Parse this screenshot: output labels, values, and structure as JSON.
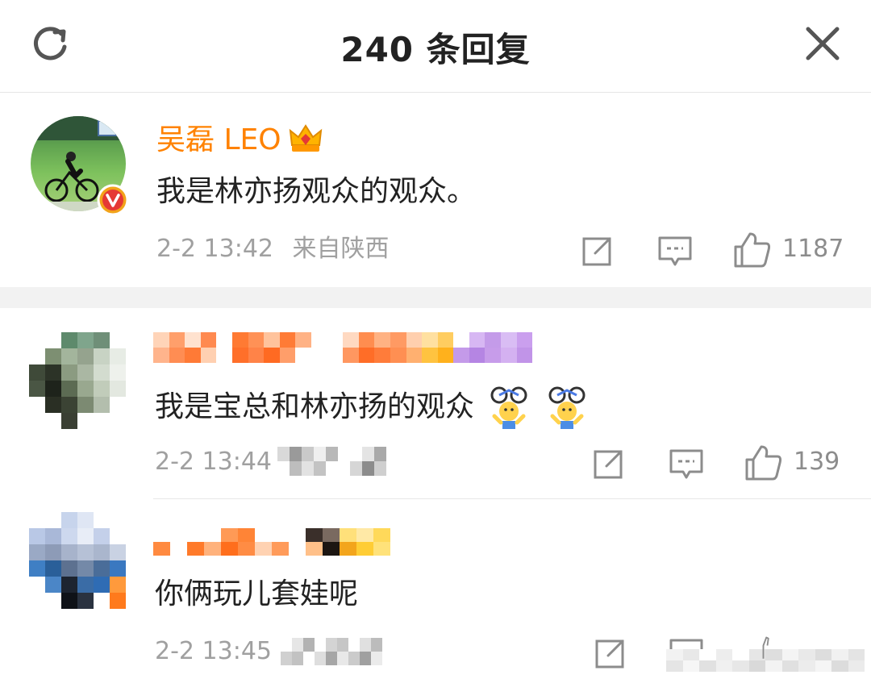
{
  "header": {
    "title": "240 条回复",
    "refresh_icon": "refresh-icon",
    "close_icon": "close-icon"
  },
  "colors": {
    "brand_name": "#ff8200",
    "text": "#222222",
    "meta": "#a0a0a0",
    "verified_badge": "#e53935"
  },
  "comments": [
    {
      "author": "吴磊 LEO",
      "author_badge": "crown-badge-icon",
      "verified": true,
      "text": "我是林亦扬观众的观众。",
      "time": "2-2 13:42",
      "location": "来自陕西",
      "likes": "1187"
    },
    {
      "author": "",
      "text": "我是宝总和林亦扬的观众",
      "emojis": [
        "cyclist-emoji",
        "cyclist-emoji"
      ],
      "time": "2-2 13:44",
      "likes": "139"
    },
    {
      "author": "",
      "text": "你俩玩儿套娃呢",
      "time": "2-2 13:45"
    }
  ]
}
